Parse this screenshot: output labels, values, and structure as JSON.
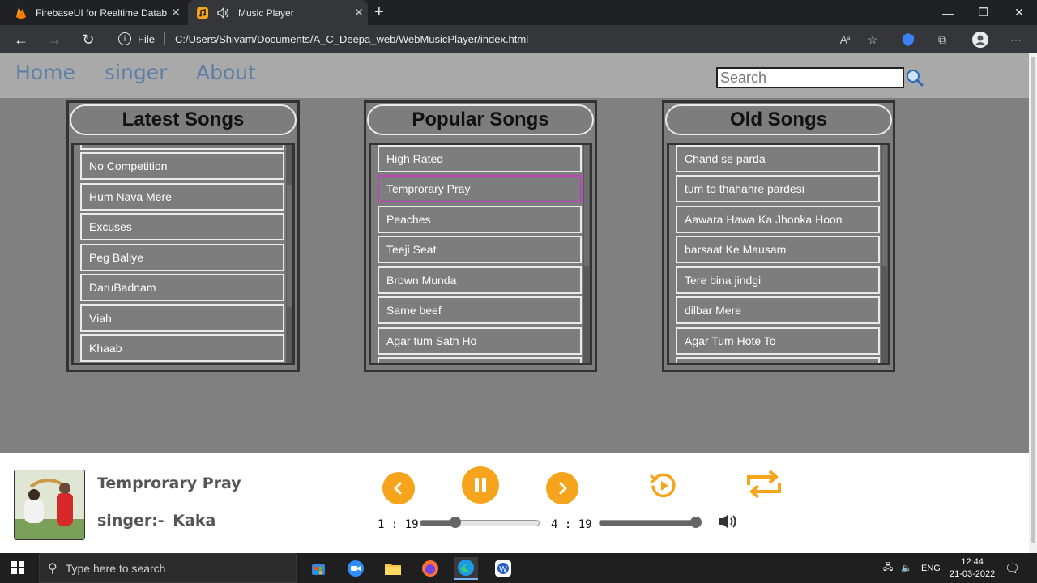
{
  "browser": {
    "tabs": [
      {
        "title": "FirebaseUI for Realtime Database"
      },
      {
        "title": "Music Player"
      }
    ],
    "url_prefix": "File",
    "url": "C:/Users/Shivam/Documents/A_C_Deepa_web/WebMusicPlayer/index.html"
  },
  "nav": {
    "links": [
      "Home",
      "singer",
      "About"
    ],
    "search_placeholder": "Search"
  },
  "panels": [
    {
      "title": "Latest Songs",
      "songs": [
        "No Competition",
        "Hum Nava Mere",
        "Excuses",
        "Peg Baliye",
        "DaruBadnam",
        "Viah",
        "Khaab"
      ]
    },
    {
      "title": "Popular Songs",
      "songs": [
        "High Rated",
        "Temprorary Pray",
        "Peaches",
        "Teeji Seat",
        "Brown Munda",
        "Same beef",
        "Agar tum Sath Ho"
      ],
      "active_index": 1
    },
    {
      "title": "Old Songs",
      "songs": [
        "Chand se parda",
        "tum to thahahre pardesi",
        "Aawara Hawa Ka Jhonka Hoon",
        "barsaat Ke Mausam",
        "Tere bina jindgi",
        "dilbar Mere",
        "Agar Tum Hote To"
      ]
    }
  ],
  "player": {
    "title": "Temprorary Pray",
    "singer": "singer:- Kaka",
    "current_time": "1 : 19",
    "duration": "4 : 19",
    "progress_fraction": 0.3,
    "volume_fraction": 1.0,
    "accent_color": "#f5a41c"
  },
  "taskbar": {
    "search_placeholder": "Type here to search",
    "language": "ENG",
    "time": "12:44",
    "date": "21-03-2022"
  }
}
